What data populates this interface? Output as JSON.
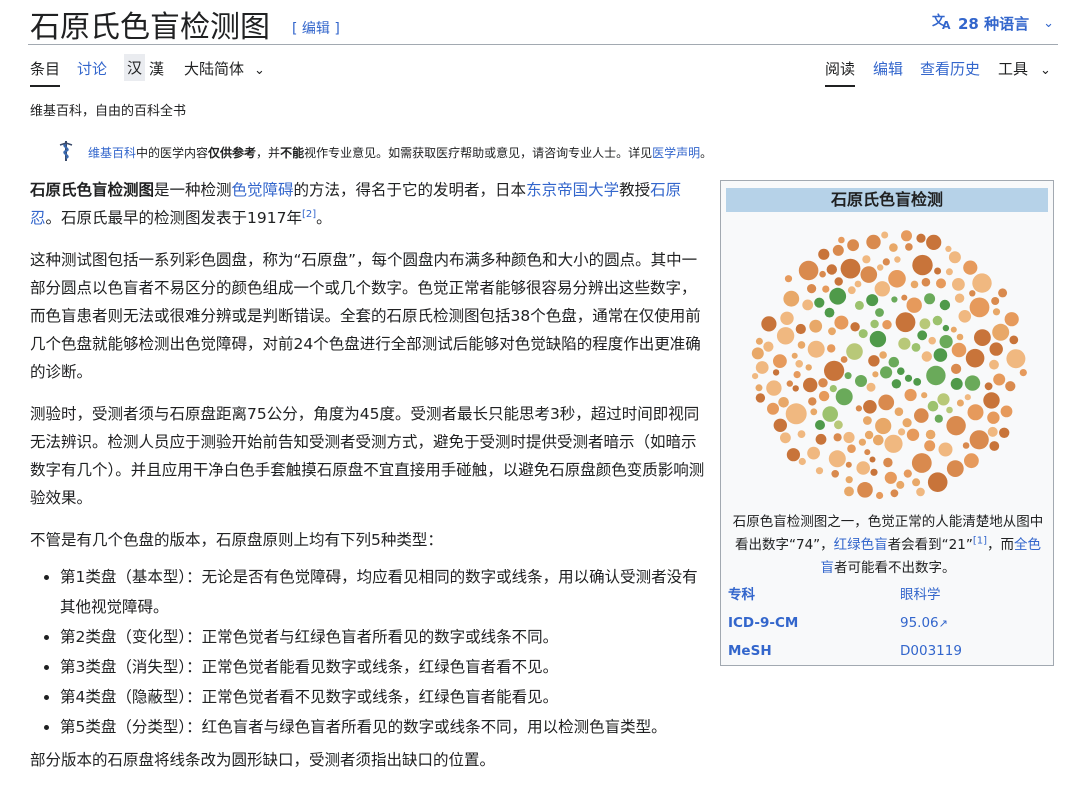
{
  "page": {
    "title": "石原氏色盲检测图",
    "edit_link": "[ 编辑 ]",
    "languages": "28 种语言",
    "tagline": "维基百科，自由的百科全书"
  },
  "tabs": {
    "article": "条目",
    "talk": "讨论",
    "zh_simplified": "汉",
    "zh_traditional": "漢",
    "variant": "大陆简体",
    "read": "阅读",
    "edit": "编辑",
    "history": "查看历史",
    "tools": "工具"
  },
  "notice": {
    "link1": "维基百科",
    "text1": "中的医学内容",
    "bold1": "仅供参考",
    "text2": "，并",
    "bold2": "不能",
    "text3": "视作专业意见。如需获取医疗帮助或意见，请咨询专业人士。详见",
    "link2": "医学声明",
    "text4": "。"
  },
  "article": {
    "p1": {
      "term": "石原氏色盲检测图",
      "t1": "是一种检测",
      "l1": "色觉障碍",
      "t2": "的方法，得名于它的发明者，日本",
      "l2": "东京帝国大学",
      "t3": "教授",
      "l3": "石原忍",
      "t4": "。石原氏最早的检测图发表于1917年",
      "ref": "[2]",
      "t5": "。"
    },
    "p2": "这种测试图包括一系列彩色圆盘，称为“石原盘”，每个圆盘内布满多种颜色和大小的圆点。其中一部分圆点以色盲者不易区分的颜色组成一个或几个数字。色觉正常者能够很容易分辨出这些数字，而色盲患者则无法或很难分辨或是判断错误。全套的石原氏检测图包括38个色盘，通常在仅使用前几个色盘就能够检测出色觉障碍，对前24个色盘进行全部测试后能够对色觉缺陷的程度作出更准确的诊断。",
    "p3": "测验时，受测者须与石原盘距离75公分，角度为45度。受测者最长只能思考3秒，超过时间即视同无法辨识。检测人员应于测验开始前告知受测者受测方式，避免于受测时提供受测者暗示（如暗示数字有几个）。并且应用干净白色手套触摸石原盘不宜直接用手碰触，以避免石原盘颜色变质影响测验效果。",
    "p4": "不管是有几个色盘的版本，石原盘原则上均有下列5种类型：",
    "list": [
      "第1类盘（基本型）：无论是否有色觉障碍，均应看见相同的数字或线条，用以确认受测者没有其他视觉障碍。",
      "第2类盘（变化型）：正常色觉者与红绿色盲者所看见的数字或线条不同。",
      "第3类盘（消失型）：正常色觉者能看见数字或线条，红绿色盲者看不见。",
      "第4类盘（隐蔽型）：正常色觉者看不见数字或线条，红绿色盲者能看见。",
      "第5类盘（分类型）：红色盲者与绿色盲者所看见的数字或线条不同，用以检测色盲类型。"
    ],
    "p5": "部分版本的石原盘将线条改为圆形缺口，受测者须指出缺口的位置。"
  },
  "infobox": {
    "title": "石原氏色盲检测",
    "caption": {
      "t1": "石原色盲检测图之一，色觉正常的人能清楚地从图中看出数字“74”，",
      "l1": "红绿色盲",
      "t2": "者会看到“21”",
      "ref": "[1]",
      "t3": "，而",
      "l2": "全色盲",
      "t4": "者可能看不出数字。"
    },
    "rows": [
      {
        "key": "专科",
        "value": "眼科学"
      },
      {
        "key": "ICD-9-CM",
        "value": "95.06"
      },
      {
        "key": "MeSH",
        "value": "D003119"
      }
    ]
  },
  "colors": {
    "link": "#3366cc",
    "infobox_header": "#b6d2e8",
    "plate_background_dots": [
      "#d98a4e",
      "#e8a868",
      "#c8743a",
      "#f0b880",
      "#e69a5c"
    ],
    "plate_figure_dots": [
      "#6aaa5a",
      "#9cc26e",
      "#4f9a4a",
      "#b8c878"
    ]
  },
  "icons": {
    "language": "translate-icon",
    "chevron": "chevron-down-icon",
    "notice": "medical-staff-icon",
    "external": "external-link-icon"
  }
}
